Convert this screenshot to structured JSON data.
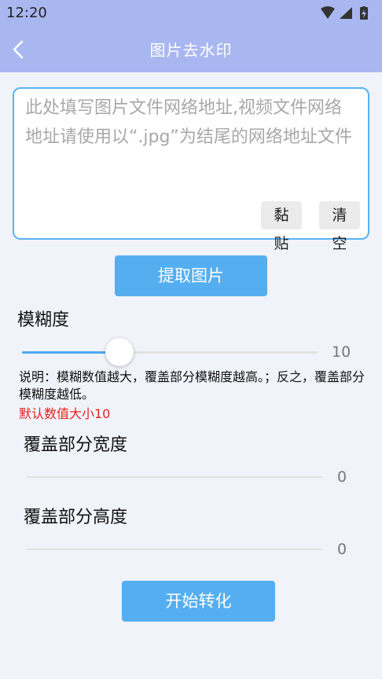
{
  "status_bar": {
    "time": "12:20",
    "icons": [
      "wifi-icon",
      "signal-icon",
      "battery-charging-icon"
    ]
  },
  "app_bar": {
    "back_icon": "chevron-left-icon",
    "title": "图片去水印"
  },
  "url_input": {
    "value": "",
    "placeholder": "此处填写图片文件网络地址,视频文件网络地址请使用以“.jpg”为结尾的网络地址文件",
    "paste_label": "黏贴",
    "clear_label": "清空"
  },
  "extract_button": "提取图片",
  "blur": {
    "label": "模糊度",
    "value": "10",
    "level": 0.33,
    "description": "说明：模糊数值越大，覆盖部分模糊度越高。；反之，覆盖部分模糊度越低。",
    "default_note": "默认数值大小10"
  },
  "cover_width": {
    "label": "覆盖部分宽度",
    "value": "0"
  },
  "cover_height": {
    "label": "覆盖部分高度",
    "value": "0"
  },
  "start_button": "开始转化",
  "colors": {
    "header": "#a9b7f1",
    "accent": "#55aef0",
    "warning_text": "#e8201e",
    "background": "#f1f3fa"
  }
}
